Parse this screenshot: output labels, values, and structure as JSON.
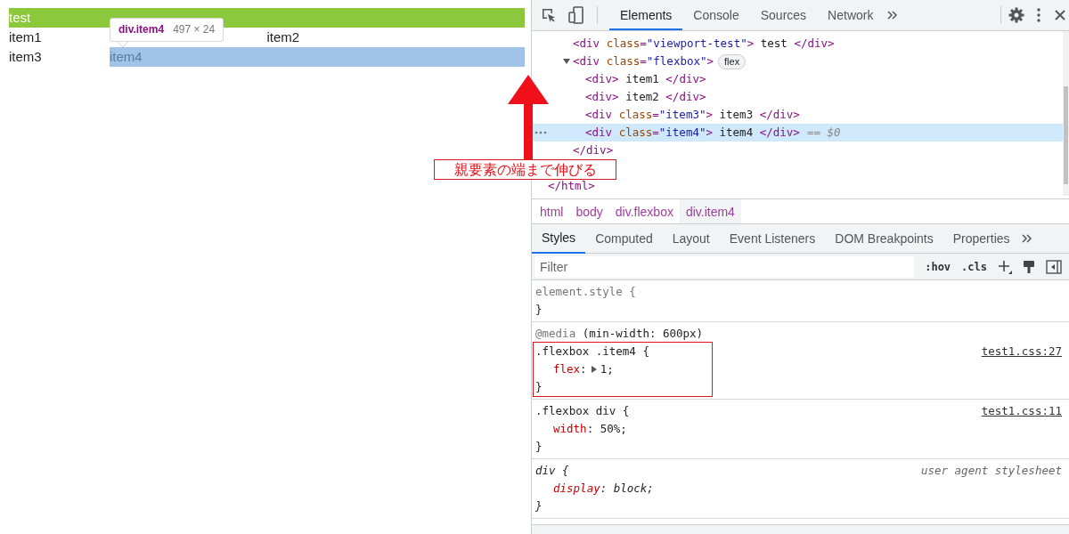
{
  "page": {
    "banner": "test",
    "items": [
      {
        "text": "item1",
        "highlighted": false
      },
      {
        "text": "item2",
        "highlighted": false
      },
      {
        "text": "item3",
        "highlighted": false
      },
      {
        "text": "item4",
        "highlighted": true
      }
    ]
  },
  "tooltip": {
    "selector": "div.item4",
    "size": "497 × 24"
  },
  "annotation": {
    "text": "親要素の端まで伸びる"
  },
  "devtools": {
    "tabs": [
      {
        "label": "Elements",
        "selected": true
      },
      {
        "label": "Console",
        "selected": false
      },
      {
        "label": "Sources",
        "selected": false
      },
      {
        "label": "Network",
        "selected": false
      }
    ],
    "dom_tree": [
      {
        "children": [
          {
            "children": [
              {
                "markup": "<div class=\"viewport-test\"> test </div>",
                "selected": false
              },
              {
                "markup": "<div class=\"flexbox\">",
                "badge": "flex",
                "expanded": true,
                "selected": false,
                "closing": "</div>",
                "children": [
                  {
                    "markup": "<div> item1 </div>",
                    "selected": false
                  },
                  {
                    "markup": "<div> item2 </div>",
                    "selected": false
                  },
                  {
                    "markup": "<div class=\"item3\"> item3 </div>",
                    "selected": false
                  },
                  {
                    "markup": "<div class=\"item4\"> item4 </div>",
                    "suffix": "== $0",
                    "selected": true
                  }
                ]
              }
            ]
          }
        ],
        "closing": "</html>"
      }
    ],
    "breadcrumbs": [
      {
        "label": "html",
        "selected": false
      },
      {
        "label": "body",
        "selected": false
      },
      {
        "label": "div.flexbox",
        "selected": false
      },
      {
        "label": "div.item4",
        "selected": true
      }
    ],
    "subtabs": [
      {
        "label": "Styles",
        "selected": true
      },
      {
        "label": "Computed",
        "selected": false
      },
      {
        "label": "Layout",
        "selected": false
      },
      {
        "label": "Event Listeners",
        "selected": false
      },
      {
        "label": "DOM Breakpoints",
        "selected": false
      },
      {
        "label": "Properties",
        "selected": false
      }
    ],
    "filter": {
      "placeholder": "Filter"
    },
    "filter_buttons": [
      ":hov",
      ".cls"
    ],
    "rules": [
      {
        "kind": "inline",
        "selector": "element.style {",
        "closing": "}",
        "highlighted": false
      },
      {
        "kind": "author",
        "media_keyword": "@media",
        "media_query": "(min-width: 600px)",
        "selector": ".flexbox .item4 {",
        "source": "test1.css:27",
        "closing": "}",
        "declarations": [
          {
            "text": "flex: 1;",
            "expandable": true
          }
        ],
        "highlighted": true
      },
      {
        "kind": "author",
        "selector": ".flexbox div {",
        "source": "test1.css:11",
        "closing": "}",
        "declarations": [
          {
            "text": "width: 50%;",
            "expandable": false
          }
        ],
        "highlighted": false
      },
      {
        "kind": "user-agent",
        "selector": "div {",
        "source": "user agent stylesheet",
        "closing": "}",
        "declarations": [
          {
            "text": "display: block;",
            "expandable": false
          }
        ],
        "highlighted": false
      }
    ]
  }
}
